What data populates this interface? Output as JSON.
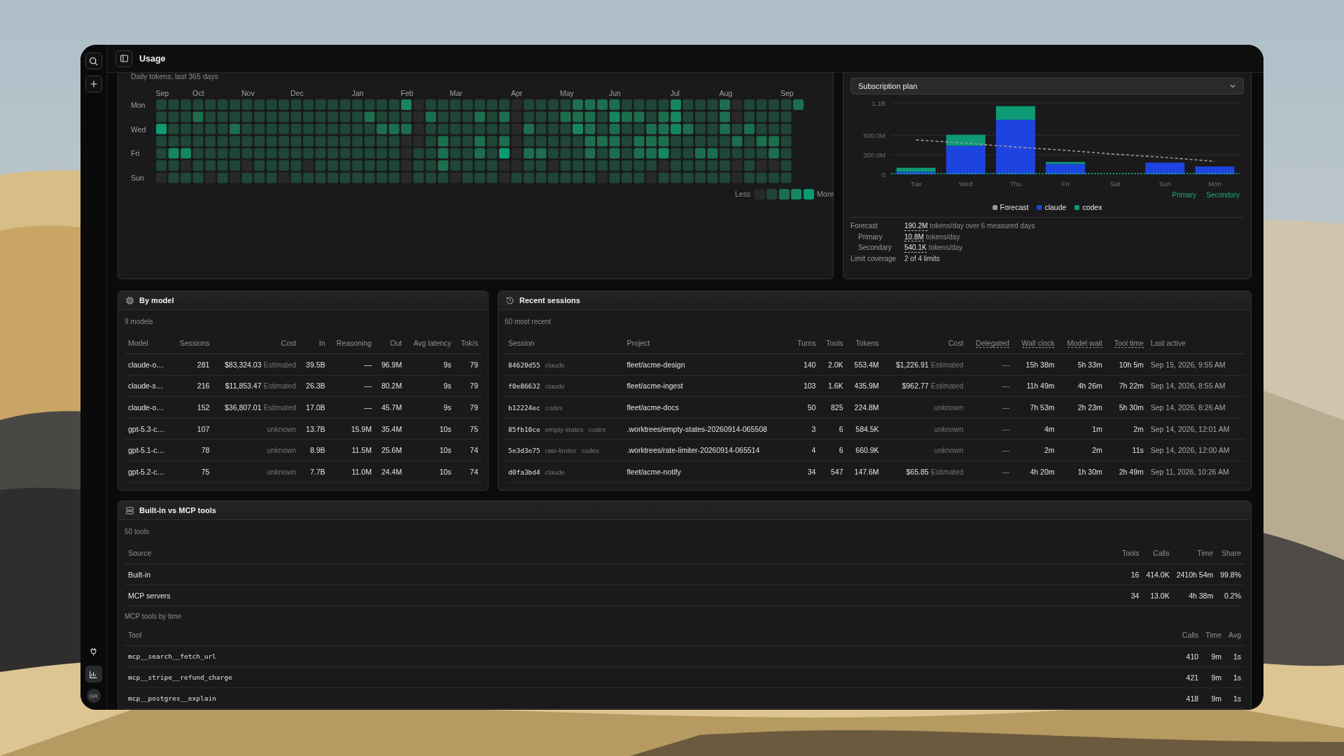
{
  "sidebar": {
    "items": [
      {
        "kind": "plug",
        "selected": false
      },
      {
        "kind": "chart",
        "selected": true
      }
    ],
    "avatar": "GR"
  },
  "header": {
    "title": "Usage"
  },
  "heatmap": {
    "caption": "Daily tokens, last 365 days",
    "months": [
      "Sep",
      "Oct",
      "Nov",
      "Dec",
      "Jan",
      "Feb",
      "Mar",
      "Apr",
      "May",
      "Jun",
      "Jul",
      "Aug",
      "Sep"
    ],
    "days": [
      "Mon",
      "Wed",
      "Fri",
      "Sun"
    ],
    "legend_low": "Less",
    "legend_high": "More"
  },
  "forecast": {
    "plan": "Subscription plan",
    "chart_data": {
      "type": "bar",
      "stacked": true,
      "categories": [
        "Tue",
        "Wed",
        "Thu",
        "Fri",
        "Sat",
        "Sun",
        "Mon"
      ],
      "ylim": [
        0,
        1100000000
      ],
      "yticks": [
        {
          "value": 0,
          "label": "0"
        },
        {
          "value": 300000000,
          "label": "300.0M"
        },
        {
          "value": 600000000,
          "label": "600.0M"
        },
        {
          "value": 1100000000,
          "label": "1.1B"
        }
      ],
      "series": [
        {
          "name": "Forecast",
          "type": "line",
          "line_style": "dashed",
          "color": "#9a9a9e",
          "values": [
            530000000,
            480000000,
            420000000,
            370000000,
            310000000,
            260000000,
            200000000
          ]
        },
        {
          "name": "claude",
          "type": "bar",
          "color": "#1e44e0",
          "values": [
            40000000,
            440000000,
            840000000,
            160000000,
            0,
            180000000,
            120000000
          ]
        },
        {
          "name": "codex",
          "type": "bar",
          "color": "#0e9a74",
          "values": [
            60000000,
            170000000,
            210000000,
            30000000,
            0,
            0,
            0
          ]
        }
      ],
      "annotations": [
        {
          "text": "Primary",
          "y": 0
        },
        {
          "text": "Secondary",
          "y": 0
        }
      ]
    },
    "stats": [
      {
        "label": "Forecast",
        "indent": false,
        "value": "190.2M",
        "underlined": true,
        "detail": "tokens/day over 6 measured days"
      },
      {
        "label": "Primary",
        "indent": true,
        "value": "10.8M",
        "underlined": true,
        "detail": "tokens/day"
      },
      {
        "label": "Secondary",
        "indent": true,
        "value": "540.1K",
        "underlined": true,
        "detail": "tokens/day"
      },
      {
        "label": "Limit coverage",
        "indent": false,
        "value": "2 of 4 limits",
        "underlined": false
      }
    ]
  },
  "by_model": {
    "title": "By model",
    "subtitle": "9 models",
    "columns": [
      "Model",
      "Sessions",
      "Cost",
      "In",
      "Reasoning",
      "Out",
      "Avg latency",
      "Tok/s"
    ],
    "rows": [
      {
        "model": "claude-o…",
        "sessions": "281",
        "cost": "$83,324.03",
        "cost_note": "Estimated",
        "in": "39.5B",
        "reasoning": "—",
        "out": "96.9M",
        "latency": "9s",
        "tok_s": "79"
      },
      {
        "model": "claude-s…",
        "sessions": "216",
        "cost": "$11,853.47",
        "cost_note": "Estimated",
        "in": "26.3B",
        "reasoning": "—",
        "out": "80.2M",
        "latency": "9s",
        "tok_s": "79"
      },
      {
        "model": "claude-o…",
        "sessions": "152",
        "cost": "$36,807.01",
        "cost_note": "Estimated",
        "in": "17.0B",
        "reasoning": "—",
        "out": "45.7M",
        "latency": "9s",
        "tok_s": "79"
      },
      {
        "model": "gpt-5.3-c…",
        "sessions": "107",
        "cost_note": "unknown",
        "in": "13.7B",
        "reasoning": "15.9M",
        "out": "35.4M",
        "latency": "10s",
        "tok_s": "75"
      },
      {
        "model": "gpt-5.1-c…",
        "sessions": "78",
        "cost_note": "unknown",
        "in": "8.9B",
        "reasoning": "11.5M",
        "out": "25.6M",
        "latency": "10s",
        "tok_s": "74"
      },
      {
        "model": "gpt-5.2-c…",
        "sessions": "75",
        "cost_note": "unknown",
        "in": "7.7B",
        "reasoning": "11.0M",
        "out": "24.4M",
        "latency": "10s",
        "tok_s": "74"
      }
    ]
  },
  "recent_sessions": {
    "title": "Recent sessions",
    "subtitle": "50 most recent",
    "columns": [
      {
        "label": "Session",
        "underlined": false
      },
      {
        "label": "Project",
        "underlined": false
      },
      {
        "label": "Turns",
        "underlined": false
      },
      {
        "label": "Tools",
        "underlined": false
      },
      {
        "label": "Tokens",
        "underlined": false
      },
      {
        "label": "Cost",
        "underlined": false
      },
      {
        "label": "Delegated",
        "underlined": true
      },
      {
        "label": "Wall clock",
        "underlined": true
      },
      {
        "label": "Model wait",
        "underlined": true
      },
      {
        "label": "Tool time",
        "underlined": true
      },
      {
        "label": "Last active",
        "underlined": false
      }
    ],
    "rows": [
      {
        "session": "84620d55",
        "tags": [
          "claude"
        ],
        "project": "fleet/acme-design",
        "turns": "140",
        "tools": "2.0K",
        "tokens": "553.4M",
        "cost": "$1,226.91",
        "cost_note": "Estimated",
        "delegated": "—",
        "wall_clock": "15h 38m",
        "model_wait": "5h 33m",
        "tool_time": "10h 5m",
        "last_active": "Sep 15, 2026, 9:55 AM"
      },
      {
        "session": "f0e86632",
        "tags": [
          "claude"
        ],
        "project": "fleet/acme-ingest",
        "turns": "103",
        "tools": "1.6K",
        "tokens": "435.9M",
        "cost": "$962.77",
        "cost_note": "Estimated",
        "delegated": "—",
        "wall_clock": "11h 49m",
        "model_wait": "4h 26m",
        "tool_time": "7h 22m",
        "last_active": "Sep 14, 2026, 8:55 AM"
      },
      {
        "session": "b12224ec",
        "tags": [
          "codex"
        ],
        "project": "fleet/acme-docs",
        "turns": "50",
        "tools": "825",
        "tokens": "224.8M",
        "cost_note": "unknown",
        "delegated": "—",
        "wall_clock": "7h 53m",
        "model_wait": "2h 23m",
        "tool_time": "5h 30m",
        "last_active": "Sep 14, 2026, 8:26 AM"
      },
      {
        "session": "85fb10ce",
        "tags": [
          "empty-states",
          "codex"
        ],
        "project": ".worktrees/empty-states-20260914-065508",
        "turns": "3",
        "tools": "6",
        "tokens": "584.5K",
        "cost_note": "unknown",
        "delegated": "—",
        "wall_clock": "4m",
        "model_wait": "1m",
        "tool_time": "2m",
        "last_active": "Sep 14, 2026, 12:01 AM"
      },
      {
        "session": "5e3d3e75",
        "tags": [
          "rate-limiter",
          "codex"
        ],
        "project": ".worktrees/rate-limiter-20260914-065514",
        "turns": "4",
        "tools": "6",
        "tokens": "660.9K",
        "cost_note": "unknown",
        "delegated": "—",
        "wall_clock": "2m",
        "model_wait": "2m",
        "tool_time": "11s",
        "last_active": "Sep 14, 2026, 12:00 AM"
      },
      {
        "session": "d0fa3bd4",
        "tags": [
          "claude"
        ],
        "project": "fleet/acme-notify",
        "turns": "34",
        "tools": "547",
        "tokens": "147.6M",
        "cost": "$65.85",
        "cost_note": "Estimated",
        "delegated": "—",
        "wall_clock": "4h 20m",
        "model_wait": "1h 30m",
        "tool_time": "2h 49m",
        "last_active": "Sep 11, 2026, 10:26 AM"
      }
    ]
  },
  "tools": {
    "title": "Built-in vs MCP tools",
    "subtitle": "50 tools",
    "source_columns": [
      "Source",
      "Tools",
      "Calls",
      "Time",
      "Share"
    ],
    "sources": [
      [
        "Built-in",
        "16",
        "414.0K",
        "2410h 54m",
        "99.8%"
      ],
      [
        "MCP servers",
        "34",
        "13.0K",
        "4h 38m",
        "0.2%"
      ]
    ],
    "mcp_caption": "MCP tools by time",
    "mcp_columns": [
      "Tool",
      "Calls",
      "Time",
      "Avg"
    ],
    "mcp_tools": [
      [
        "mcp__search__fetch_url",
        "410",
        "9m",
        "1s"
      ],
      [
        "mcp__stripe__refund_charge",
        "421",
        "9m",
        "1s"
      ],
      [
        "mcp__postgres__explain",
        "418",
        "9m",
        "1s"
      ]
    ]
  }
}
